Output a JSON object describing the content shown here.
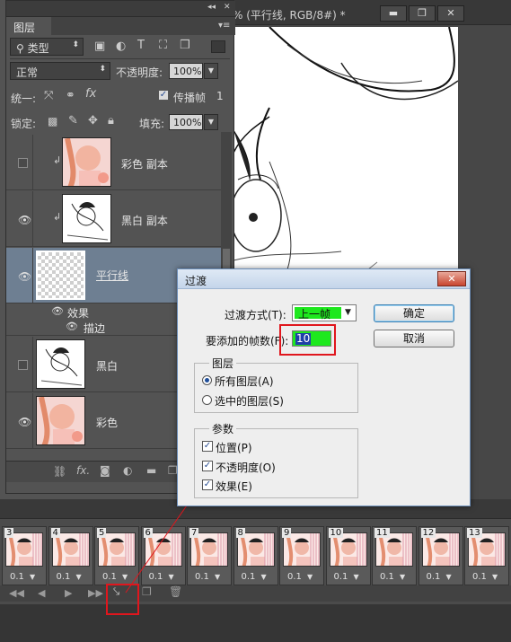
{
  "document": {
    "title": "% (平行线, RGB/8#) *",
    "buttons": [
      "▬",
      "❐",
      "✕"
    ]
  },
  "layers_panel": {
    "tab_label": "图层",
    "collapse_glyph": "◂◂",
    "close_glyph": "✕",
    "filter_kind": "类型",
    "blend_mode": "正常",
    "opacity_label": "不透明度:",
    "opacity_value": "100%",
    "unify_label": "统一:",
    "propagate_label": "传播帧",
    "propagate_value": "1",
    "lock_label": "锁定:",
    "fill_label": "填充:",
    "fill_value": "100%",
    "layers": [
      {
        "name": "彩色 副本",
        "visible": false,
        "linked": true
      },
      {
        "name": "黑白 副本",
        "visible": true,
        "linked": true
      },
      {
        "name": "平行线",
        "visible": true,
        "selected": true
      },
      {
        "name": "黑白",
        "visible": false
      },
      {
        "name": "彩色",
        "visible": true
      }
    ],
    "effects_label": "效果",
    "stroke_label": "描边",
    "footer_icons": [
      "link-icon",
      "fx-icon",
      "mask-icon",
      "adjustment-icon",
      "folder-icon",
      "new-layer-icon",
      "trash-icon"
    ]
  },
  "timeline": {
    "frames": [
      {
        "num": "3",
        "delay": "0.1"
      },
      {
        "num": "4",
        "delay": "0.1"
      },
      {
        "num": "5",
        "delay": "0.1"
      },
      {
        "num": "6",
        "delay": "0.1"
      },
      {
        "num": "7",
        "delay": "0.1"
      },
      {
        "num": "8",
        "delay": "0.1"
      },
      {
        "num": "9",
        "delay": "0.1"
      },
      {
        "num": "10",
        "delay": "0.1"
      },
      {
        "num": "11",
        "delay": "0.1"
      },
      {
        "num": "12",
        "delay": "0.1"
      },
      {
        "num": "13",
        "delay": "0.1"
      }
    ],
    "controls": [
      "◀◀",
      "◀",
      "▶",
      "▶▶"
    ]
  },
  "dialog": {
    "title": "过渡",
    "close_glyph": "✕",
    "method_label": "过渡方式(T):",
    "method_value": "上一帧",
    "frames_label": "要添加的帧数(F):",
    "frames_value": "10",
    "ok_label": "确定",
    "cancel_label": "取消",
    "layers_group": "图层",
    "all_layers": "所有图层(A)",
    "selected_layers": "选中的图层(S)",
    "params_group": "参数",
    "position": "位置(P)",
    "opacity": "不透明度(O)",
    "effects": "效果(E)"
  },
  "colors": {
    "highlight_green": "#1ee81e",
    "annotation_red": "#e0161d",
    "selected_layer": "#6e7f92"
  }
}
